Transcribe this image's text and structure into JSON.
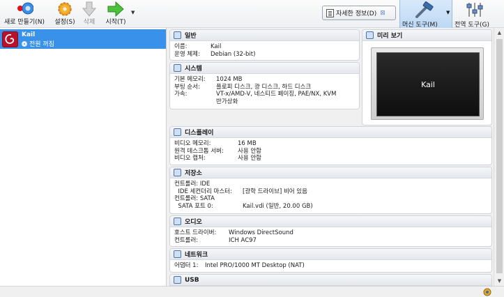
{
  "toolbar": {
    "new_label": "새로 만들기(N)",
    "settings_label": "설정(S)",
    "discard_label": "삭제",
    "start_label": "시작(T)",
    "details_label": "자세한 정보(D)",
    "machine_tools_label": "머신 도구(M)",
    "global_tools_label": "전역 도구(G)"
  },
  "vm": {
    "name": "Kail",
    "state": "전원 꺼짐"
  },
  "sections": {
    "general": {
      "title": "일반",
      "rows": [
        {
          "k": "이름:",
          "v": "Kail"
        },
        {
          "k": "운영 체제:",
          "v": "Debian (32-bit)"
        }
      ]
    },
    "system": {
      "title": "시스템",
      "rows": [
        {
          "k": "기본 메모리:",
          "v": "1024 MB"
        },
        {
          "k": "부팅 순서:",
          "v": "플로피 디스크, 광 디스크, 하드 디스크"
        },
        {
          "k": "가속:",
          "v": "VT-x/AMD-V, 네스티드 페이징, PAE/NX, KVM"
        },
        {
          "k": "",
          "v": "반가상화"
        }
      ]
    },
    "preview": {
      "title": "미리 보기",
      "screen_text": "Kail"
    },
    "display": {
      "title": "디스플레이",
      "rows": [
        {
          "k": "비디오 메모리:",
          "v": "16 MB"
        },
        {
          "k": "원격 데스크톱 서버:",
          "v": "사용 안함"
        },
        {
          "k": "비디오 캡처:",
          "v": "사용 안함"
        }
      ]
    },
    "storage": {
      "title": "저장소",
      "lines": [
        {
          "k": "컨트롤러: IDE",
          "v": ""
        },
        {
          "k": "  IDE 세컨더리 마스터:",
          "v": "[광학 드라이브] 비어 있음"
        },
        {
          "k": "컨트롤러: SATA",
          "v": ""
        },
        {
          "k": "  SATA 포트 0:",
          "v": "Kail.vdi (일반, 20.00 GB)"
        }
      ]
    },
    "audio": {
      "title": "오디오",
      "rows": [
        {
          "k": "호스트 드라이버:",
          "v": "Windows DirectSound"
        },
        {
          "k": "컨트롤러:",
          "v": "ICH AC97"
        }
      ]
    },
    "network": {
      "title": "네트워크",
      "rows": [
        {
          "k": "어댑터 1:",
          "v": "Intel PRO/1000 MT Desktop (NAT)"
        }
      ]
    },
    "usb": {
      "title": "USB"
    }
  },
  "colors": {
    "selection": "#3a91ea",
    "accent": "#4a73a8"
  }
}
